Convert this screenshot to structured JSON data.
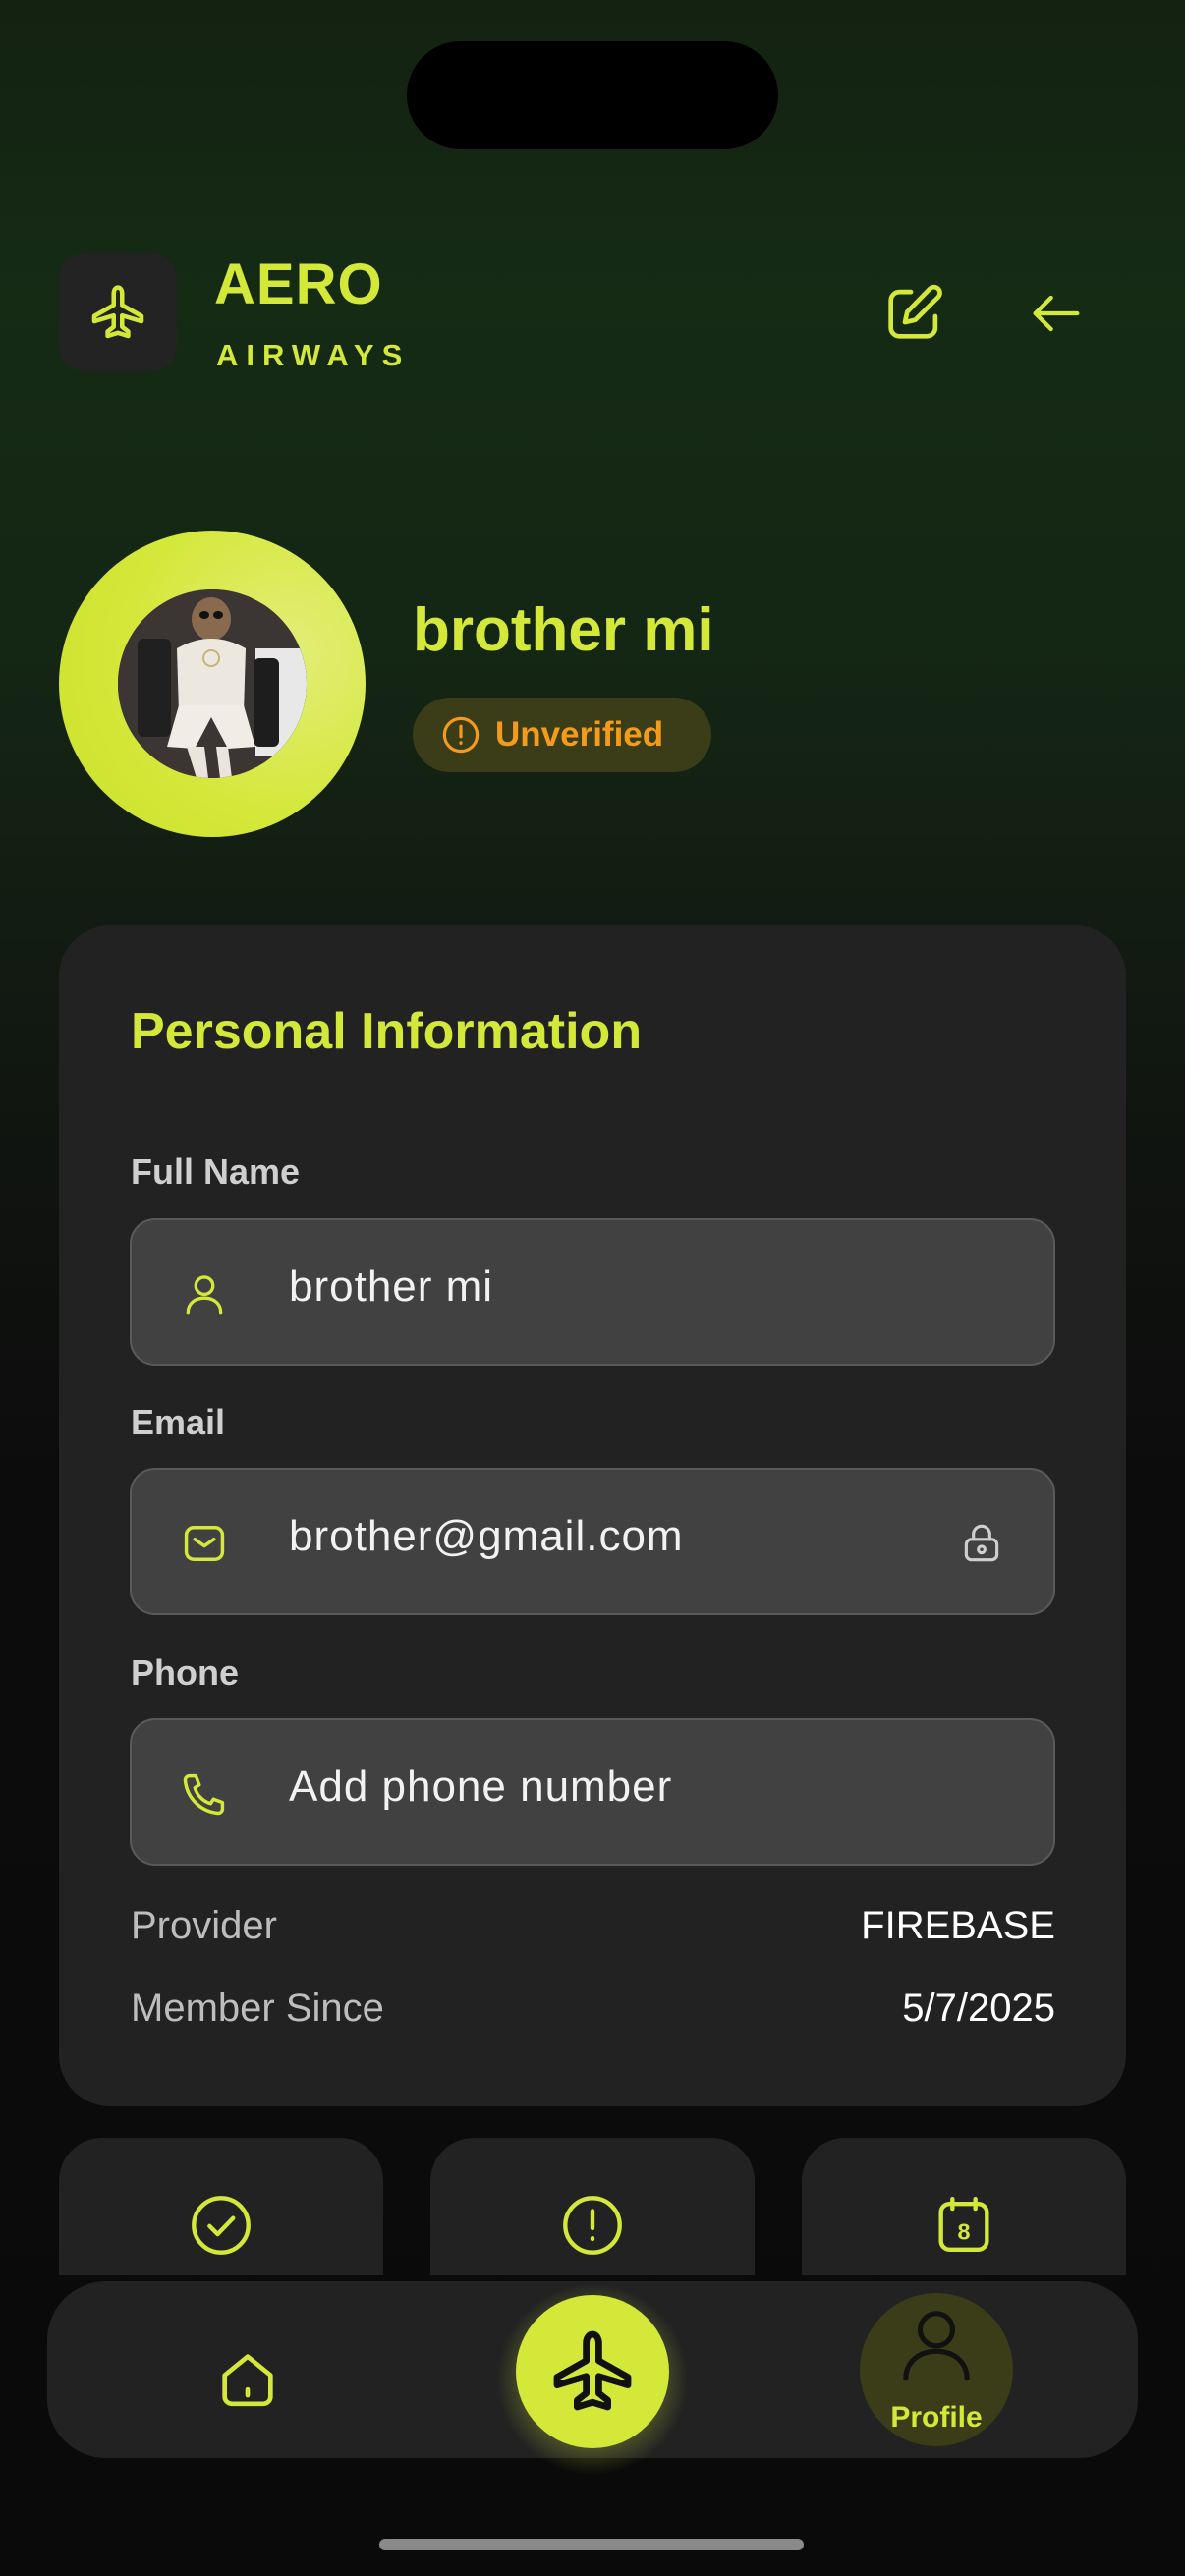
{
  "header": {
    "brand_title": "AERO",
    "brand_subtitle": "AIRWAYS",
    "logo_icon": "plane-icon",
    "edit_icon": "edit-icon",
    "back_icon": "arrow-left-icon"
  },
  "profile": {
    "name": "brother mi",
    "status_label": "Unverified",
    "status_icon": "alert-circle-icon",
    "status_color": "#f59b1b"
  },
  "personal_info": {
    "title": "Personal Information",
    "full_name": {
      "label": "Full Name",
      "value": "brother mi",
      "icon": "user-icon"
    },
    "email": {
      "label": "Email",
      "value": "brother@gmail.com",
      "icon": "mail-icon",
      "trailing_icon": "lock-icon"
    },
    "phone": {
      "label": "Phone",
      "placeholder": "Add phone number",
      "icon": "phone-icon"
    },
    "provider": {
      "label": "Provider",
      "value": "FIREBASE"
    },
    "member_since": {
      "label": "Member Since",
      "value": "5/7/2025"
    }
  },
  "stat_cards": [
    {
      "icon": "check-circle-icon"
    },
    {
      "icon": "alert-circle-icon"
    },
    {
      "icon": "calendar-icon",
      "icon_text": "8"
    }
  ],
  "nav": {
    "home_icon": "home-icon",
    "center_icon": "plane-icon",
    "profile_label": "Profile",
    "profile_icon": "user-icon"
  },
  "colors": {
    "accent": "#d4e83a",
    "card_bg": "#222222",
    "field_bg": "#414141",
    "warning": "#f59b1b"
  }
}
